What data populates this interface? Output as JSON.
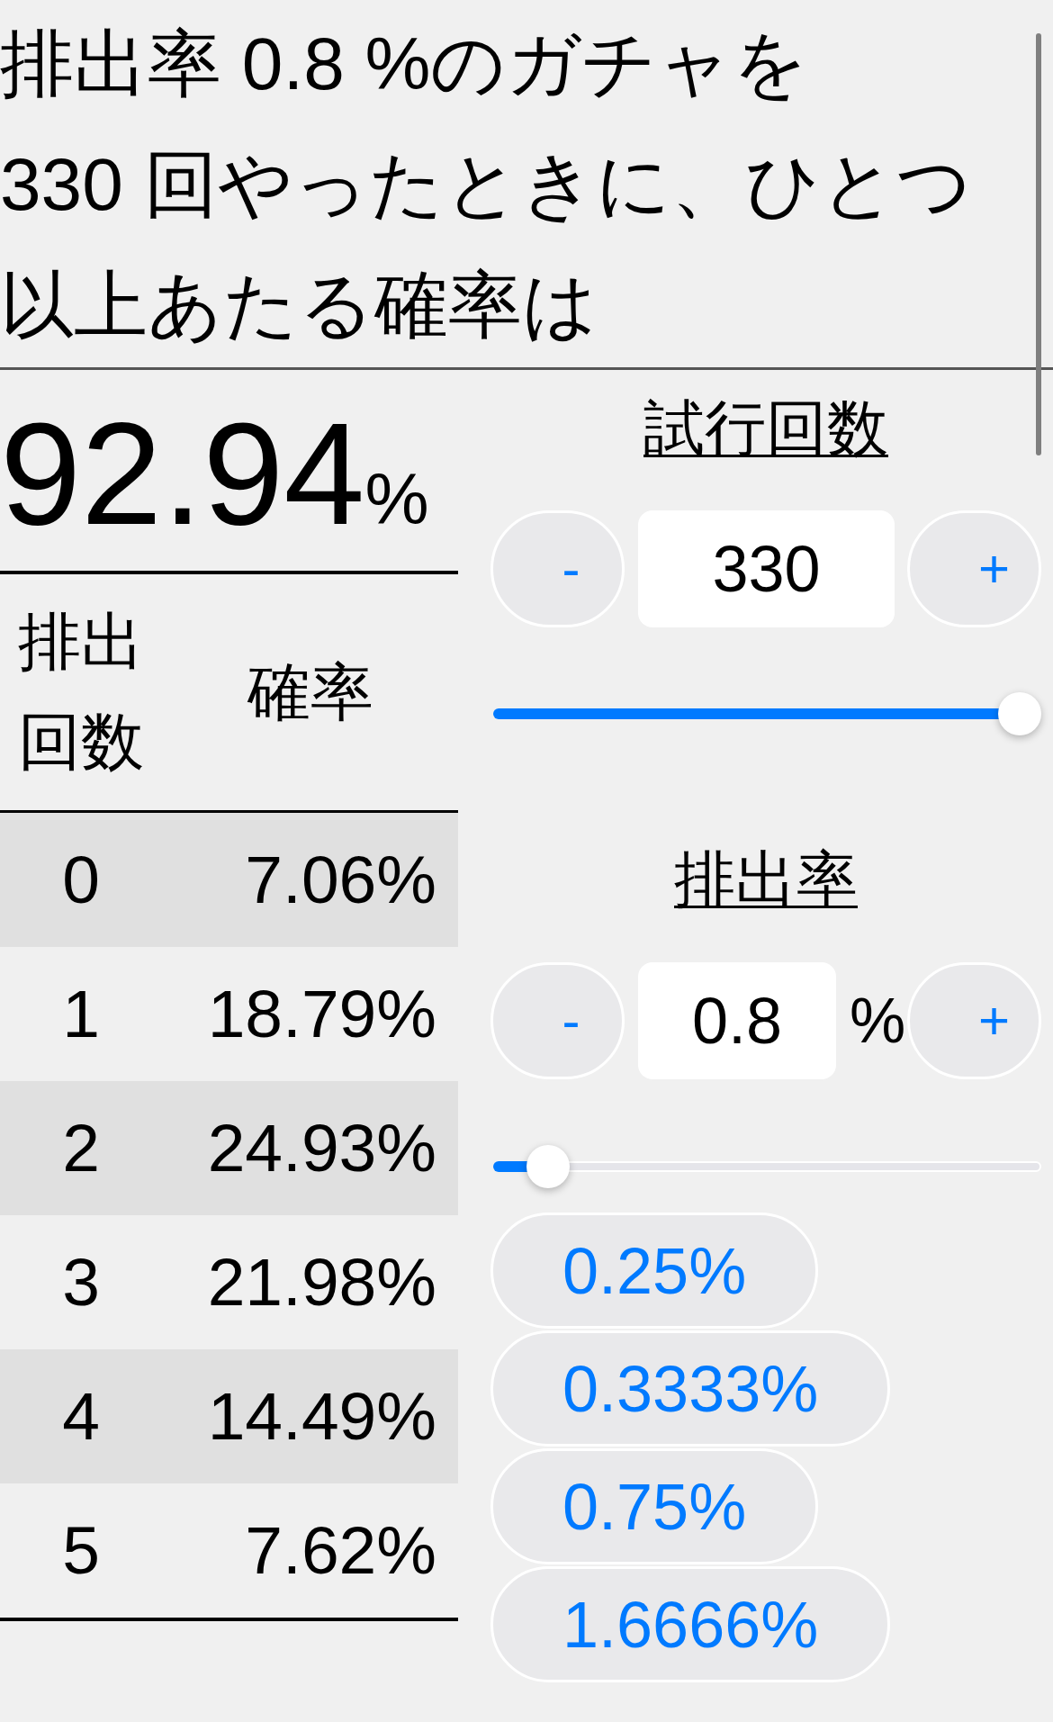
{
  "question": "排出率 0.8 %のガチャを\n330 回やったときに、ひとつ以上あたる確率は",
  "result": {
    "value": "92.94",
    "unit": "%"
  },
  "table": {
    "columns": [
      "排出回数",
      "確率"
    ],
    "rows": [
      {
        "count": "0",
        "probability": "7.06%"
      },
      {
        "count": "1",
        "probability": "18.79%"
      },
      {
        "count": "2",
        "probability": "24.93%"
      },
      {
        "count": "3",
        "probability": "21.98%"
      },
      {
        "count": "4",
        "probability": "14.49%"
      },
      {
        "count": "5",
        "probability": "7.62%"
      }
    ]
  },
  "trials": {
    "title": "試行回数",
    "decrement": "-",
    "value": "330",
    "increment": "+",
    "slider": {
      "level": 1
    }
  },
  "rate": {
    "title": "排出率",
    "decrement": "-",
    "value": "0.8",
    "unit": "%",
    "increment": "+",
    "slider": {
      "level": 0.066
    },
    "presets": [
      "0.25%",
      "0.3333%",
      "0.75%",
      "1.6666%"
    ]
  }
}
